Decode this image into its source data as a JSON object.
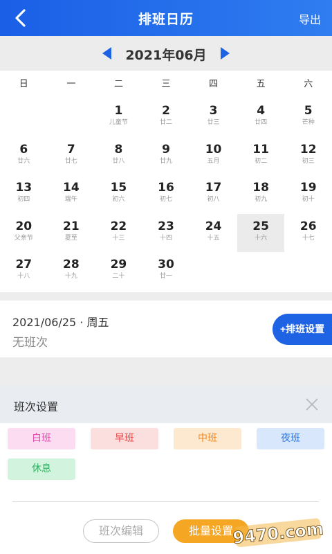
{
  "header": {
    "title": "排班日历",
    "export_label": "导出"
  },
  "month": {
    "title": "2021年06月"
  },
  "weekdays": [
    "日",
    "一",
    "二",
    "三",
    "四",
    "五",
    "六"
  ],
  "days": [
    {
      "num": "",
      "lunar": ""
    },
    {
      "num": "",
      "lunar": ""
    },
    {
      "num": "1",
      "lunar": "儿童节"
    },
    {
      "num": "2",
      "lunar": "廿二"
    },
    {
      "num": "3",
      "lunar": "廿三"
    },
    {
      "num": "4",
      "lunar": "廿四"
    },
    {
      "num": "5",
      "lunar": "芒种"
    },
    {
      "num": "6",
      "lunar": "廿六"
    },
    {
      "num": "7",
      "lunar": "廿七"
    },
    {
      "num": "8",
      "lunar": "廿八"
    },
    {
      "num": "9",
      "lunar": "廿九"
    },
    {
      "num": "10",
      "lunar": "五月"
    },
    {
      "num": "11",
      "lunar": "初二"
    },
    {
      "num": "12",
      "lunar": "初三"
    },
    {
      "num": "13",
      "lunar": "初四"
    },
    {
      "num": "14",
      "lunar": "端午"
    },
    {
      "num": "15",
      "lunar": "初六"
    },
    {
      "num": "16",
      "lunar": "初七"
    },
    {
      "num": "17",
      "lunar": "初八"
    },
    {
      "num": "18",
      "lunar": "初九"
    },
    {
      "num": "19",
      "lunar": "初十"
    },
    {
      "num": "20",
      "lunar": "父亲节"
    },
    {
      "num": "21",
      "lunar": "夏至"
    },
    {
      "num": "22",
      "lunar": "十三"
    },
    {
      "num": "23",
      "lunar": "十四"
    },
    {
      "num": "24",
      "lunar": "十五"
    },
    {
      "num": "25",
      "lunar": "十六",
      "selected": true
    },
    {
      "num": "26",
      "lunar": "十七"
    },
    {
      "num": "27",
      "lunar": "十八"
    },
    {
      "num": "28",
      "lunar": "十九"
    },
    {
      "num": "29",
      "lunar": "二十"
    },
    {
      "num": "30",
      "lunar": "廿一"
    }
  ],
  "selected_info": {
    "date": "2021/06/25 · 周五",
    "status": "无班次",
    "set_button": "+排班设置"
  },
  "shift_panel": {
    "title": "班次设置",
    "shifts": [
      "白班",
      "早班",
      "中班",
      "夜班",
      "休息"
    ],
    "edit_button": "班次编辑",
    "batch_button": "批量设置"
  },
  "watermark": {
    "text": "9470.com"
  },
  "colors": {
    "primary": "#1e63e3",
    "accent": "#f5a623"
  }
}
